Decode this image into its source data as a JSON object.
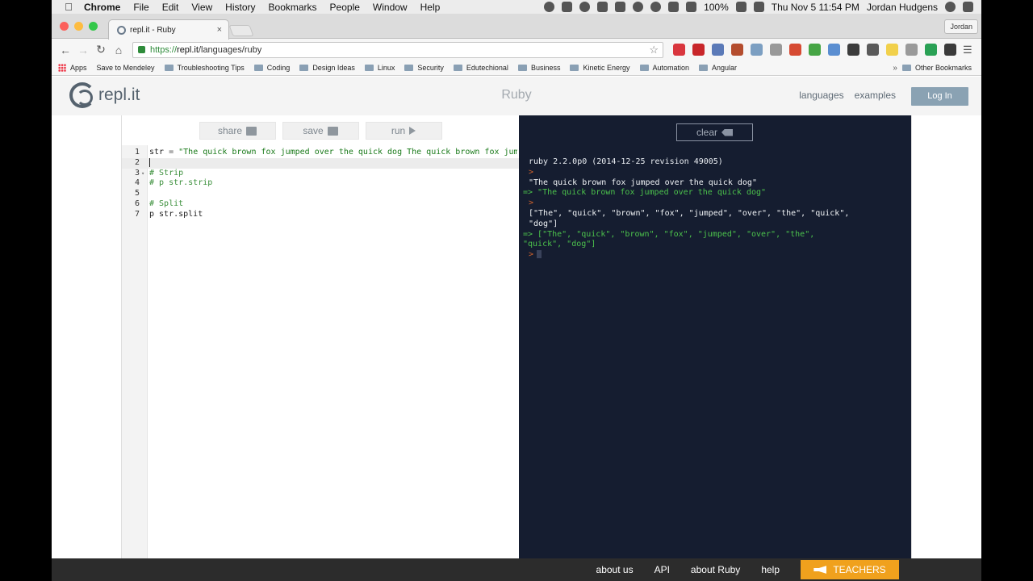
{
  "menubar": {
    "apple_icon": "apple-icon",
    "items": [
      "Chrome",
      "File",
      "Edit",
      "View",
      "History",
      "Bookmarks",
      "People",
      "Window",
      "Help"
    ],
    "battery": "100%",
    "datetime": "Thu Nov 5  11:54 PM",
    "user": "Jordan Hudgens"
  },
  "browser": {
    "tab_title": "repl.it - Ruby",
    "tab_close": "×",
    "profile": "Jordan",
    "url_scheme": "https://",
    "url_host": "repl.it",
    "url_path": "/languages/ruby",
    "bookmarks": [
      {
        "label": "Apps",
        "kind": "grid"
      },
      {
        "label": "Save to Mendeley",
        "kind": "page"
      },
      {
        "label": "Troubleshooting Tips",
        "kind": "folder"
      },
      {
        "label": "Coding",
        "kind": "folder"
      },
      {
        "label": "Design Ideas",
        "kind": "folder"
      },
      {
        "label": "Linux",
        "kind": "folder"
      },
      {
        "label": "Security",
        "kind": "folder"
      },
      {
        "label": "Edutechional",
        "kind": "folder"
      },
      {
        "label": "Business",
        "kind": "folder"
      },
      {
        "label": "Kinetic Energy",
        "kind": "folder"
      },
      {
        "label": "Automation",
        "kind": "folder"
      },
      {
        "label": "Angular",
        "kind": "folder"
      }
    ],
    "bookmarks_more": "»",
    "other_bookmarks": "Other Bookmarks",
    "extension_colors": [
      "#d9363e",
      "#c8262a",
      "#5b7ab8",
      "#b44d2e",
      "#7c9fc2",
      "#999999",
      "#d64a32",
      "#46a545",
      "#5a8ed1",
      "#3c3c3c",
      "#5a5a5a",
      "#f1d04b",
      "#9a9a9a",
      "#2aa155",
      "#3a3a3a"
    ]
  },
  "site": {
    "logo_text": "repl.it",
    "title": "Ruby",
    "nav": [
      "languages",
      "examples"
    ],
    "login": "Log In"
  },
  "editor": {
    "share": "share",
    "save": "save",
    "run": "run",
    "lines": [
      {
        "n": "1",
        "fold": "",
        "segments": [
          {
            "t": "str ",
            "c": ""
          },
          {
            "t": "= ",
            "c": "op"
          },
          {
            "t": "\"The quick brown fox jumped over the quick dog The quick brown fox jumpe",
            "c": "str"
          }
        ]
      },
      {
        "n": "2",
        "fold": "",
        "segments": [],
        "active": true
      },
      {
        "n": "3",
        "fold": "▾",
        "segments": [
          {
            "t": "# Strip",
            "c": "com"
          }
        ]
      },
      {
        "n": "4",
        "fold": "",
        "segments": [
          {
            "t": "# p str.strip",
            "c": "com"
          }
        ]
      },
      {
        "n": "5",
        "fold": "",
        "segments": []
      },
      {
        "n": "6",
        "fold": "",
        "segments": [
          {
            "t": "# Split",
            "c": "com"
          }
        ]
      },
      {
        "n": "7",
        "fold": "",
        "segments": [
          {
            "t": "p str.split",
            "c": ""
          }
        ]
      }
    ]
  },
  "console": {
    "clear": "clear",
    "lines": [
      {
        "kind": "header",
        "text": "ruby 2.2.0p0 (2014-12-25 revision 49005)"
      },
      {
        "kind": "prompt",
        "text": ">"
      },
      {
        "kind": "out",
        "text": "\"The quick brown fox jumped over the quick dog\""
      },
      {
        "kind": "res",
        "text": "=> \"The quick brown fox jumped over the quick dog\""
      },
      {
        "kind": "prompt",
        "text": ">"
      },
      {
        "kind": "out",
        "text": "[\"The\", \"quick\", \"brown\", \"fox\", \"jumped\", \"over\", \"the\", \"quick\",\n\"dog\"]"
      },
      {
        "kind": "res",
        "text": "=> [\"The\", \"quick\", \"brown\", \"fox\", \"jumped\", \"over\", \"the\",\n\"quick\", \"dog\"]"
      }
    ],
    "final_prompt": ">"
  },
  "footer": {
    "links": [
      "about us",
      "API",
      "about Ruby",
      "help"
    ],
    "teachers": "TEACHERS"
  }
}
